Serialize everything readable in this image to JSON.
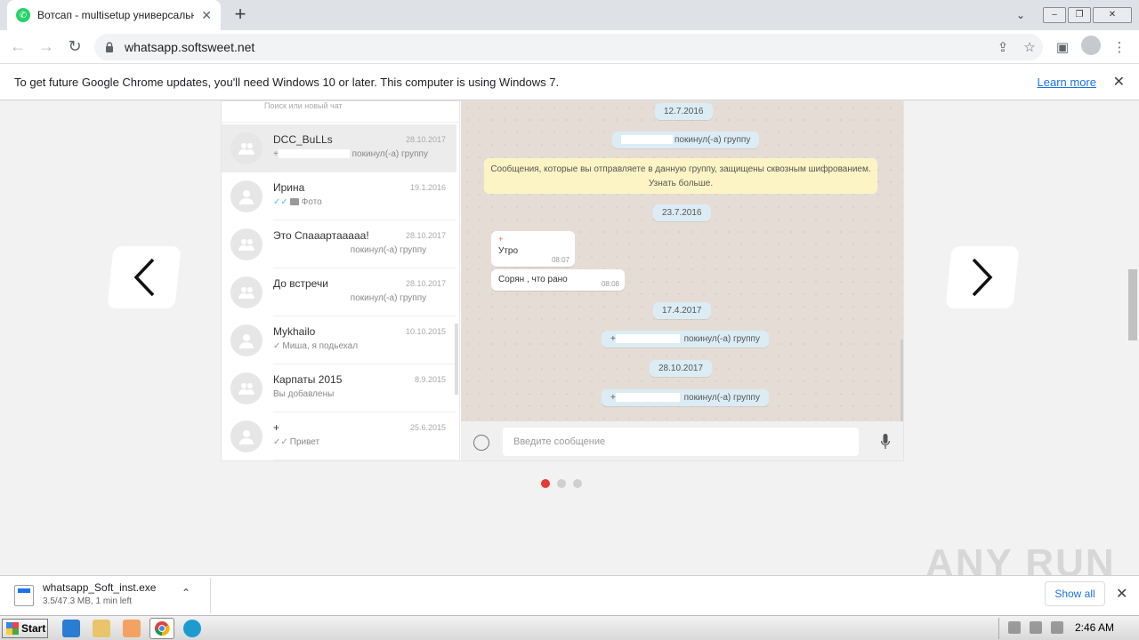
{
  "browser": {
    "tab_title": "Вотсап - multisetup универсальный",
    "url": "whatsapp.softsweet.net"
  },
  "infobar": {
    "message": "To get future Google Chrome updates, you'll need Windows 10 or later. This computer is using Windows 7.",
    "learn_more": "Learn more"
  },
  "whatsapp": {
    "search_placeholder": "Поиск или новый чат",
    "chats": [
      {
        "name": "DCC_BuLLs",
        "date": "28.10.2017",
        "prefix": "+",
        "message": "покинул(-а) группу",
        "type": "group",
        "active": true
      },
      {
        "name": "Ирина",
        "date": "19.1.2016",
        "message": "Фото",
        "type": "person"
      },
      {
        "name": "Это Спааартааааа!",
        "date": "28.10.2017",
        "message": "покинул(-а) группу",
        "type": "group"
      },
      {
        "name": "До встречи",
        "date": "28.10.2017",
        "message": "покинул(-а) группу",
        "type": "group"
      },
      {
        "name": "Mykhailo",
        "date": "10.10.2015",
        "message": "Миша, я подьехал",
        "type": "person"
      },
      {
        "name": "Карпаты 2015",
        "date": "8.9.2015",
        "message": "Вы добавлены",
        "type": "group"
      },
      {
        "name": "+",
        "date": "25.6.2015",
        "message": "Привет",
        "type": "person"
      }
    ],
    "conversation": {
      "date1": "12.7.2016",
      "left_group": "покинул(-а) группу",
      "notice_line1": "Сообщения, которые вы отправляете в данную группу, защищены сквозным шифрованием.",
      "notice_line2": "Узнать больше.",
      "date2": "23.7.2016",
      "msg1_sender": "+",
      "msg1_text": "Утро",
      "msg1_time": "08:07",
      "msg2_text": "Сорян , что рано",
      "msg2_time": "08:08",
      "date3": "17.4.2017",
      "plus": "+",
      "date4": "28.10.2017"
    },
    "composer_placeholder": "Введите сообщение"
  },
  "download": {
    "filename": "whatsapp_Soft_inst.exe",
    "status": "3.5/47.3 MB, 1 min left",
    "show_all": "Show all"
  },
  "taskbar": {
    "start": "Start",
    "time": "2:46 AM"
  },
  "watermark": "ANY RUN"
}
